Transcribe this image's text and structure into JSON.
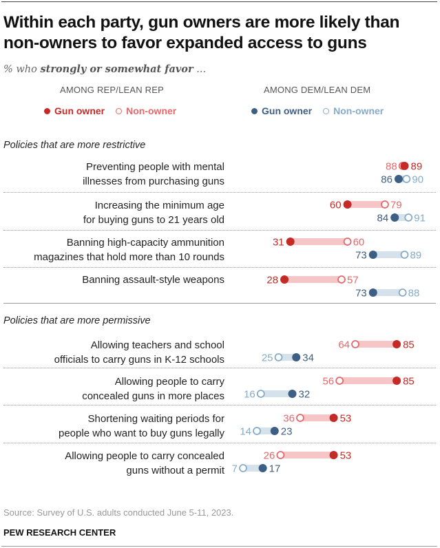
{
  "title": "Within each party, gun owners are more likely than non-owners to favor expanded access to guns",
  "subtitle_prefix": "% who ",
  "subtitle_bold": "strongly or somewhat favor",
  "subtitle_suffix": " ...",
  "groups": [
    {
      "heading": "AMONG REP/LEAN REP",
      "owner_label": "Gun owner",
      "nonowner_label": "Non-owner"
    },
    {
      "heading": "AMONG DEM/LEAN DEM",
      "owner_label": "Gun owner",
      "nonowner_label": "Non-owner"
    }
  ],
  "colors": {
    "rep_owner": "#c42b26",
    "rep_nonowner": "#e8676a",
    "rep_bar": "#f6c6c7",
    "dem_owner": "#3d5f85",
    "dem_nonowner": "#85abc8",
    "dem_bar": "#d5e2eb"
  },
  "sections": [
    {
      "label": "Policies that are more restrictive"
    },
    {
      "label": "Policies that are more permissive"
    }
  ],
  "source": "Source: Survey of U.S. adults conducted June 5-11, 2023.",
  "credit": "PEW RESEARCH CENTER",
  "chart_data": {
    "type": "dot-plot",
    "title": "Within each party, gun owners are more likely than non-owners to favor expanded access to guns",
    "subtitle": "% who strongly or somewhat favor ...",
    "xlim": [
      0,
      100
    ],
    "grid": false,
    "legend": "top",
    "series_names": [
      "Rep gun owner",
      "Rep non-owner",
      "Dem gun owner",
      "Dem non-owner"
    ],
    "rows": [
      {
        "section": 0,
        "label": [
          "Preventing people with mental",
          "illnesses from purchasing guns"
        ],
        "rep_owner": 89,
        "rep_nonowner": 88,
        "dem_owner": 86,
        "dem_nonowner": 90
      },
      {
        "section": 0,
        "label": [
          "Increasing the minimum age",
          "for buying guns to 21 years old"
        ],
        "rep_owner": 60,
        "rep_nonowner": 79,
        "dem_owner": 84,
        "dem_nonowner": 91
      },
      {
        "section": 0,
        "label": [
          "Banning high-capacity ammunition",
          "magazines that hold more than 10 rounds"
        ],
        "rep_owner": 31,
        "rep_nonowner": 60,
        "dem_owner": 73,
        "dem_nonowner": 89
      },
      {
        "section": 0,
        "label": [
          "Banning assault-style weapons"
        ],
        "rep_owner": 28,
        "rep_nonowner": 57,
        "dem_owner": 73,
        "dem_nonowner": 88
      },
      {
        "section": 1,
        "label": [
          "Allowing teachers and school",
          "officials to carry guns in K-12 schools"
        ],
        "rep_owner": 85,
        "rep_nonowner": 64,
        "dem_owner": 34,
        "dem_nonowner": 25
      },
      {
        "section": 1,
        "label": [
          "Allowing people to carry",
          "concealed guns in more places"
        ],
        "rep_owner": 85,
        "rep_nonowner": 56,
        "dem_owner": 32,
        "dem_nonowner": 16
      },
      {
        "section": 1,
        "label": [
          "Shortening waiting periods for",
          "people who want to buy guns legally"
        ],
        "rep_owner": 53,
        "rep_nonowner": 36,
        "dem_owner": 23,
        "dem_nonowner": 14
      },
      {
        "section": 1,
        "label": [
          "Allowing people to carry concealed",
          "guns without a permit"
        ],
        "rep_owner": 53,
        "rep_nonowner": 26,
        "dem_owner": 17,
        "dem_nonowner": 7
      }
    ]
  }
}
